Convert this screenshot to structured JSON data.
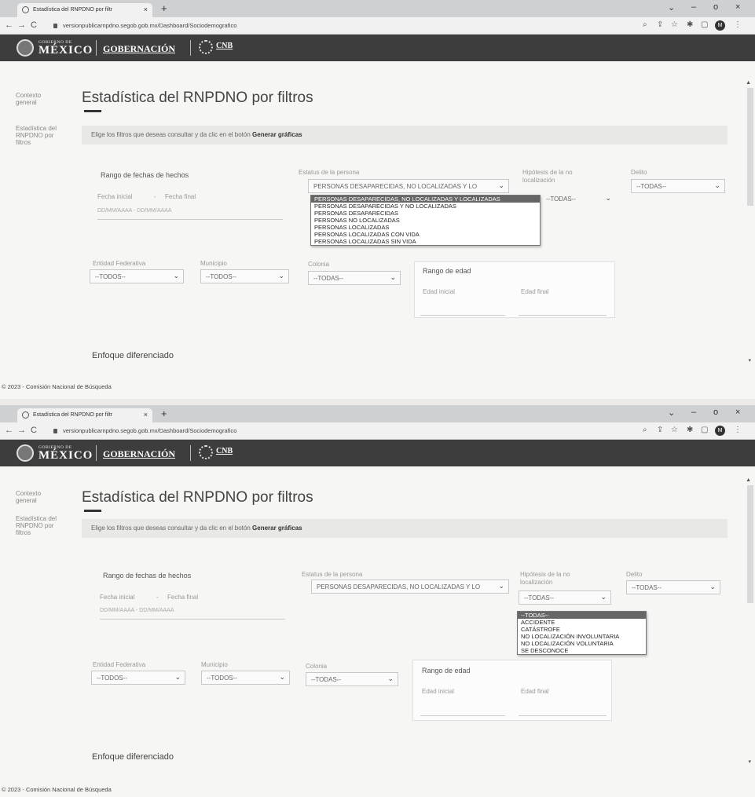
{
  "browser": {
    "tab_title": "Estadística del RNPDNO por filtr",
    "tab_close": "×",
    "new_tab": "+",
    "url": "versionpublicarnpdno.segob.gob.mx/Dashboard/Sociodemografico",
    "nav_back": "←",
    "nav_forward": "→",
    "nav_reload": "C",
    "win_minimize": "–",
    "win_restore": "o",
    "win_close": "×",
    "win_chevron": "⌄",
    "tool_icons": [
      "⌕",
      "⇪",
      "☆",
      "✱",
      "▢"
    ],
    "profile_initial": "M",
    "menu": "⋮"
  },
  "header": {
    "gobierno_de": "GOBIERNO DE",
    "mexico": "MÉXICO",
    "gobernacion": "GOBERNACIÓN",
    "cnb": "CNB"
  },
  "sidebar": {
    "items": [
      {
        "label": "Contexto general"
      },
      {
        "label": "Estadística del RNPDNO por filtros"
      }
    ]
  },
  "main": {
    "title": "Estadística del RNPDNO por filtros",
    "instructions_prefix": "Elige los filtros que deseas consultar y da clic en el botón ",
    "instructions_strong": "Generar gráficas",
    "rango_fechas": "Rango de fechas de hechos",
    "fecha_inicial": "Fecha inicial",
    "fecha_sep": "-",
    "fecha_final": "Fecha final",
    "fecha_placeholder": "DD/MM/AAAA - DD/MM/AAAA",
    "estatus_label": "Estatus de la persona",
    "estatus_value": "PERSONAS DESAPARECIDAS, NO LOCALIZADAS Y LO",
    "hipotesis_label": "Hipótesis de la no localización",
    "hipotesis_value": "--TODAS--",
    "delito_label": "Delito",
    "delito_value": "--TODAS--",
    "entidad_label": "Entidad Federativa",
    "entidad_value": "--TODOS--",
    "municipio_label": "Municipio",
    "municipio_value": "--TODOS--",
    "colonia_label": "Colonia",
    "colonia_value": "--TODAS--",
    "rango_edad": "Rango de edad",
    "edad_inicial": "Edad inicial",
    "edad_final": "Edad final",
    "enfoque": "Enfoque diferenciado",
    "chevron": "⌄"
  },
  "estatus_options": [
    "PERSONAS DESAPARECIDAS, NO LOCALIZADAS Y LOCALIZADAS",
    "PERSONAS DESAPARECIDAS Y NO LOCALIZADAS",
    "PERSONAS DESAPARECIDAS",
    "PERSONAS NO LOCALIZADAS",
    "PERSONAS LOCALIZADAS",
    "PERSONAS LOCALIZADAS CON VIDA",
    "PERSONAS LOCALIZADAS SIN VIDA"
  ],
  "hipotesis_options": [
    "--TODAS--",
    "ACCIDENTE",
    "CATÁSTROFE",
    "NO LOCALIZACIÓN INVOLUNTARIA",
    "NO LOCALIZACIÓN VOLUNTARIA",
    "SE DESCONOCE"
  ],
  "footer": "© 2023 - Comisión Nacional de Búsqueda",
  "scroll_up": "▲",
  "scroll_down": "▾"
}
